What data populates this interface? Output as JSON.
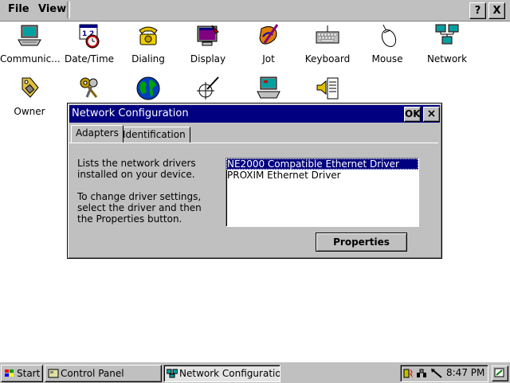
{
  "menubar": {
    "file_label": "File",
    "view_label": "View",
    "help_label": "?",
    "close_label": "X"
  },
  "icons": [
    {
      "label": "Communic...",
      "icon": "communication-laptop-icon"
    },
    {
      "label": "Date/Time",
      "icon": "calendar-clock-icon"
    },
    {
      "label": "Dialing",
      "icon": "telephone-icon"
    },
    {
      "label": "Display",
      "icon": "display-icon"
    },
    {
      "label": "Jot",
      "icon": "jot-pen-icon"
    },
    {
      "label": "Keyboard",
      "icon": "keyboard-icon"
    },
    {
      "label": "Mouse",
      "icon": "mouse-icon"
    },
    {
      "label": "Network",
      "icon": "network-icon"
    },
    {
      "label": "Owner",
      "icon": "owner-tag-icon"
    },
    {
      "label": "",
      "icon": "keys-icon"
    },
    {
      "label": "",
      "icon": "globe-icon"
    },
    {
      "label": "",
      "icon": "stylus-target-icon"
    },
    {
      "label": "",
      "icon": "system-computer-icon"
    },
    {
      "label": "",
      "icon": "volume-sounds-icon"
    }
  ],
  "dialog": {
    "title": "Network Configuration",
    "ok_label": "OK",
    "close_label": "×",
    "tabs": [
      "Adapters",
      "Identification"
    ],
    "active_tab": "Adapters",
    "description_1": "Lists the network drivers installed on your device.",
    "description_2": "To change driver settings, select the driver and then the Properties button.",
    "drivers": [
      {
        "name": "NE2000 Compatible Ethernet Driver",
        "selected": true
      },
      {
        "name": "PROXIM Ethernet Driver",
        "selected": false
      }
    ],
    "properties_label": "Properties"
  },
  "taskbar": {
    "start_label": "Start",
    "tasks": [
      {
        "label": "Control Panel",
        "active": false
      },
      {
        "label": "Network Configuration",
        "active": true
      }
    ],
    "clock": "8:47 PM"
  },
  "colors": {
    "face": "#c0c0c0",
    "titlebar": "#000080",
    "selection": "#000080"
  }
}
